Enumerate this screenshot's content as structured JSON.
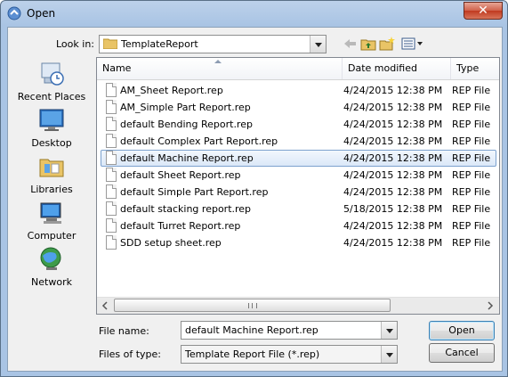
{
  "window": {
    "title": "Open",
    "close_glyph": "✕"
  },
  "toolbar": {
    "look_in_label": "Look in:",
    "look_in_value": "TemplateReport",
    "icons": [
      "back-icon",
      "up-folder-icon",
      "new-folder-icon",
      "view-menu-icon"
    ]
  },
  "places": [
    {
      "label": "Recent Places",
      "icon": "recent-places-icon"
    },
    {
      "label": "Desktop",
      "icon": "desktop-icon"
    },
    {
      "label": "Libraries",
      "icon": "libraries-icon"
    },
    {
      "label": "Computer",
      "icon": "computer-icon"
    },
    {
      "label": "Network",
      "icon": "network-icon"
    }
  ],
  "list": {
    "columns": [
      "Name",
      "Date modified",
      "Type"
    ],
    "rows": [
      {
        "name": "AM_Sheet Report.rep",
        "date": "4/24/2015 12:38 PM",
        "type": "REP File"
      },
      {
        "name": "AM_Simple Part Report.rep",
        "date": "4/24/2015 12:38 PM",
        "type": "REP File"
      },
      {
        "name": "default Bending Report.rep",
        "date": "4/24/2015 12:38 PM",
        "type": "REP File"
      },
      {
        "name": "default Complex Part Report.rep",
        "date": "4/24/2015 12:38 PM",
        "type": "REP File"
      },
      {
        "name": "default Machine Report.rep",
        "date": "4/24/2015 12:38 PM",
        "type": "REP File",
        "selected": true
      },
      {
        "name": "default Sheet Report.rep",
        "date": "4/24/2015 12:38 PM",
        "type": "REP File"
      },
      {
        "name": "default Simple Part Report.rep",
        "date": "4/24/2015 12:38 PM",
        "type": "REP File"
      },
      {
        "name": "default stacking report.rep",
        "date": "5/18/2015 12:38 PM",
        "type": "REP File"
      },
      {
        "name": "default Turret Report.rep",
        "date": "4/24/2015 12:38 PM",
        "type": "REP File"
      },
      {
        "name": "SDD setup sheet.rep",
        "date": "4/24/2015 12:38 PM",
        "type": "REP File"
      }
    ]
  },
  "form": {
    "file_name_label": "File name:",
    "file_name_value": "default Machine Report.rep",
    "files_of_type_label": "Files of type:",
    "files_of_type_value": "Template Report File (*.rep)"
  },
  "buttons": {
    "open": "Open",
    "cancel": "Cancel"
  },
  "colors": {
    "title_bar": "#a9c4e4",
    "selection": "#dbe8f8",
    "close": "#c03a20"
  }
}
